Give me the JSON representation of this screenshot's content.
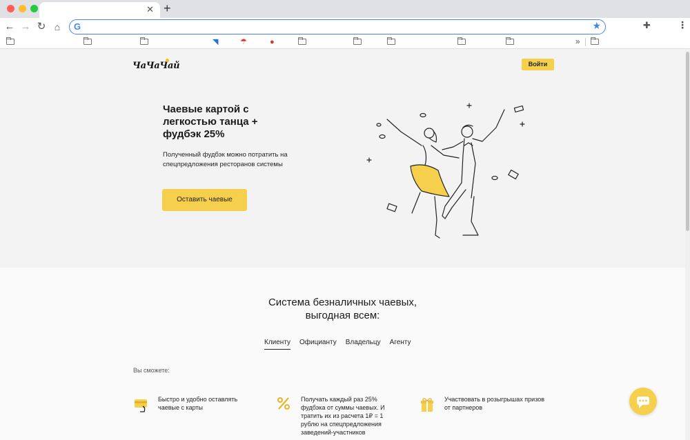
{
  "browser": {
    "address": "",
    "bookmarks_more": "»"
  },
  "header": {
    "logo": "ЧаЧаЧай",
    "login_label": "Войти"
  },
  "hero": {
    "title": "Чаевые картой с легкостью танца + фудбэк 25%",
    "subtitle": "Полученный фудбэк можно потратить на спецпредложения ресторанов системы",
    "cta_label": "Оставить чаевые"
  },
  "section": {
    "title_line1": "Система безналичных чаевых,",
    "title_line2": "выгодная всем:",
    "tabs": [
      {
        "label": "Клиенту"
      },
      {
        "label": "Официанту"
      },
      {
        "label": "Владельцу"
      },
      {
        "label": "Агенту"
      }
    ],
    "can_label": "Вы сможете:"
  },
  "features": [
    {
      "text": "Быстро и удобно оставлять чаевые с карты",
      "icon": "card-icon"
    },
    {
      "text": "Получать каждый раз 25% фудбэка от суммы чаевых. И тратить их из расчета 1₽ = 1 рублю на спецпредложения заведений-участников",
      "icon": "percent-icon"
    },
    {
      "text": "Участвовать в розыгрышах призов от партнеров",
      "icon": "gift-icon"
    }
  ],
  "colors": {
    "accent": "#f6d04d",
    "hero_bg": "#f3f3f3",
    "page_bg": "#fafafa"
  }
}
